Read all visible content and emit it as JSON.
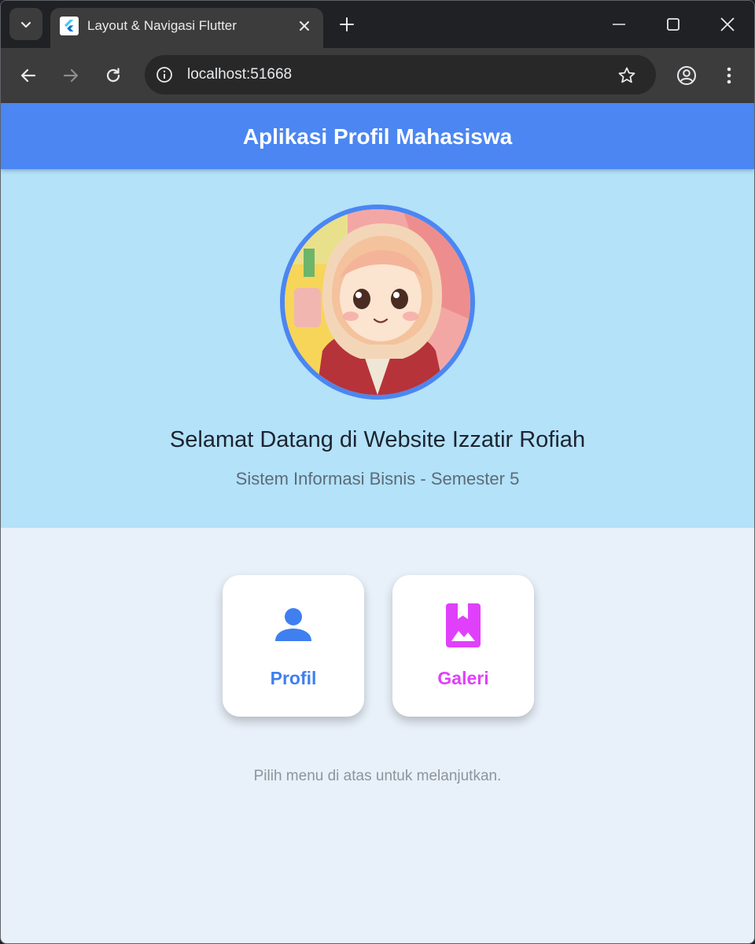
{
  "browser": {
    "tab": {
      "title": "Layout & Navigasi Flutter"
    },
    "address_bar": {
      "url": "localhost:51668"
    }
  },
  "app": {
    "appbar": {
      "title": "Aplikasi Profil Mahasiswa"
    },
    "hero": {
      "welcome": "Selamat Datang di Website Izzatir Rofiah",
      "subtitle": "Sistem Informasi Bisnis - Semester 5"
    },
    "menu": [
      {
        "label": "Profil",
        "icon": "person-icon",
        "color": "#3f7ff0"
      },
      {
        "label": "Galeri",
        "icon": "photo-album-icon",
        "color": "#e040fb"
      }
    ],
    "hint": "Pilih menu di atas untuk melanjutkan."
  },
  "colors": {
    "appbar": "#4b86f2",
    "hero_bg": "#b3e2f9",
    "page_bg": "#e8f0f9",
    "avatar_ring": "#4b86f2"
  }
}
